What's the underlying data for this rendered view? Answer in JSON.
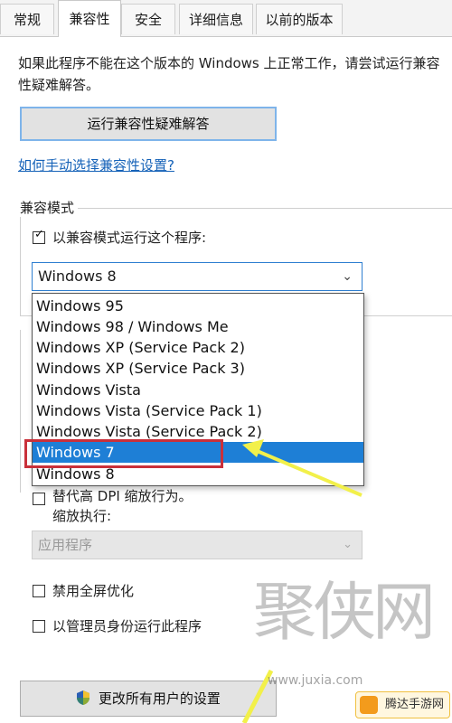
{
  "tabs": [
    {
      "label": "常规"
    },
    {
      "label": "兼容性"
    },
    {
      "label": "安全"
    },
    {
      "label": "详细信息"
    },
    {
      "label": "以前的版本"
    }
  ],
  "intro_text": "如果此程序不能在这个版本的 Windows 上正常工作，请尝试运行兼容性疑难解答。",
  "troubleshoot_button": "运行兼容性疑难解答",
  "help_link": "如何手动选择兼容性设置?",
  "compat_mode": {
    "group_title": "兼容模式",
    "checkbox_label": "以兼容模式运行这个程序:",
    "checked": true,
    "selected_value": "Windows 8",
    "options": [
      "Windows 95",
      "Windows 98 / Windows Me",
      "Windows XP (Service Pack 2)",
      "Windows XP (Service Pack 3)",
      "Windows Vista",
      "Windows Vista (Service Pack 1)",
      "Windows Vista (Service Pack 2)",
      "Windows 7",
      "Windows 8"
    ],
    "highlighted_option": "Windows 7"
  },
  "settings": {
    "dpi_override_label": "替代高 DPI 缩放行为。",
    "scaling_label": "缩放执行:",
    "scaling_value": "应用程序",
    "fullscreen_label": "禁用全屏优化",
    "admin_label": "以管理员身份运行此程序"
  },
  "all_users_button": "更改所有用户的设置",
  "watermark": {
    "logo": "聚侠网",
    "url": "www.juxia.com",
    "badge": "腾达手游网"
  },
  "colors": {
    "selection": "#1e7fd6",
    "highlight_box": "#c9303a",
    "arrow": "#f2f04a",
    "link": "#1562b8"
  }
}
